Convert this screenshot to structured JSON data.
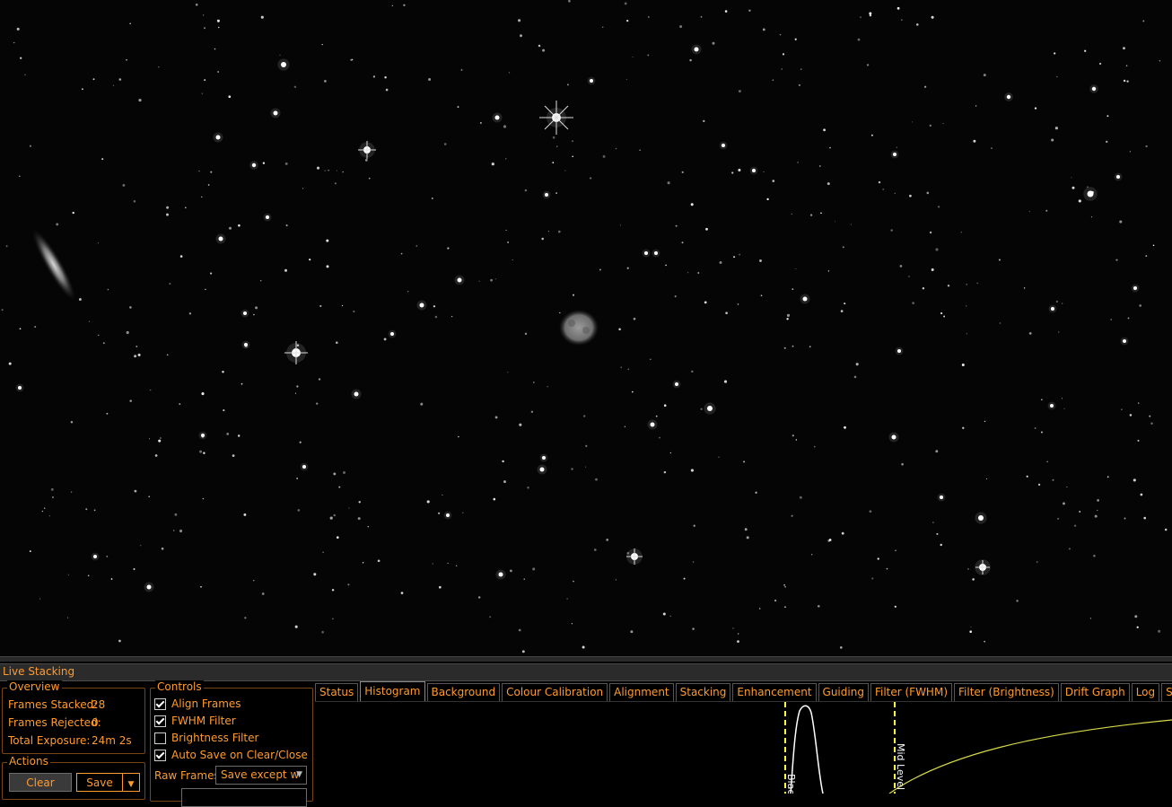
{
  "image": {
    "subject": "night-sky-star-field"
  },
  "panel": {
    "title": "Live Stacking",
    "overview": {
      "legend": "Overview",
      "frames_stacked_label": "Frames Stacked:",
      "frames_stacked_value": "28",
      "frames_rejected_label": "Frames Rejected:",
      "frames_rejected_value": "0",
      "total_exposure_label": "Total Exposure:",
      "total_exposure_value": "24m 2s"
    },
    "controls": {
      "legend": "Controls",
      "align_frames": "Align Frames",
      "fwhm_filter": "FWHM Filter",
      "brightness_filter": "Brightness Filter",
      "auto_save": "Auto Save on Clear/Close",
      "raw_frames_label": "Raw Frames",
      "raw_frames_value": "Save except w"
    },
    "actions": {
      "legend": "Actions",
      "clear": "Clear",
      "save": "Save"
    },
    "tabs": [
      "Status",
      "Histogram",
      "Background",
      "Colour Calibration",
      "Alignment",
      "Stacking",
      "Enhancement",
      "Guiding",
      "Filter (FWHM)",
      "Filter (Brightness)",
      "Drift Graph",
      "Log",
      "Settings"
    ],
    "histogram": {
      "black_label": "Black",
      "mid_label": "Mid Level"
    }
  },
  "colors": {
    "accent": "#ff9b2e",
    "marker": "#ffff3c",
    "curve": "#d8d84a"
  }
}
